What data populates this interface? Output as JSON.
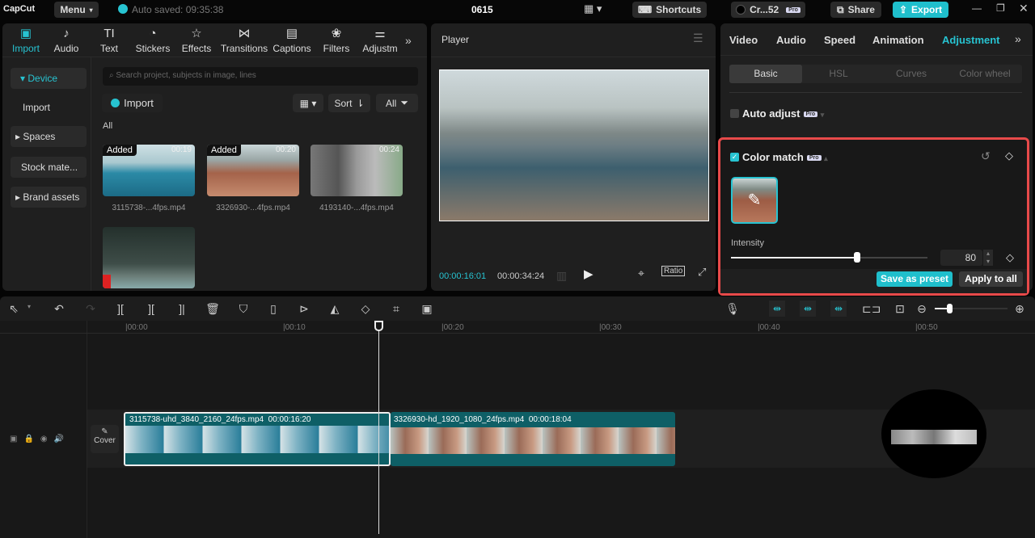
{
  "app": {
    "logo": "CapCut",
    "menu": "Menu",
    "autosave": "Auto saved: 09:35:38",
    "project": "0615",
    "shortcuts": "Shortcuts",
    "account": "Cr...52",
    "pro": "Pro",
    "share": "Share",
    "export": "Export"
  },
  "media_tabs": [
    {
      "label": "Import",
      "icon": "import-icon"
    },
    {
      "label": "Audio",
      "icon": "audio-icon"
    },
    {
      "label": "Text",
      "icon": "text-icon"
    },
    {
      "label": "Stickers",
      "icon": "stickers-icon"
    },
    {
      "label": "Effects",
      "icon": "effects-icon"
    },
    {
      "label": "Transitions",
      "icon": "transitions-icon"
    },
    {
      "label": "Captions",
      "icon": "captions-icon"
    },
    {
      "label": "Filters",
      "icon": "filters-icon"
    },
    {
      "label": "Adjustm",
      "icon": "adjustment-icon"
    }
  ],
  "sidebar": [
    "Device",
    "Import",
    "Spaces",
    "Stock mate...",
    "Brand assets"
  ],
  "media": {
    "search_placeholder": "Search project, subjects in image, lines",
    "import": "Import",
    "sort": "Sort",
    "all": "All",
    "section": "All",
    "items": [
      {
        "name": "3115738-...4fps.mp4",
        "badge": "Added",
        "duration": "00:19"
      },
      {
        "name": "3326930-...4fps.mp4",
        "badge": "Added",
        "duration": "00:20"
      },
      {
        "name": "4193140-...4fps.mp4",
        "badge": "",
        "duration": "00:24"
      },
      {
        "name": "",
        "badge": "",
        "duration": ""
      }
    ]
  },
  "player": {
    "title": "Player",
    "current": "00:00:16:01",
    "total": "00:00:34:24",
    "ratio": "Ratio"
  },
  "inspector": {
    "tabs": [
      "Video",
      "Audio",
      "Speed",
      "Animation",
      "Adjustment"
    ],
    "active_tab": "Adjustment",
    "subtabs": [
      "Basic",
      "HSL",
      "Curves",
      "Color wheel"
    ],
    "auto_adjust": "Auto adjust",
    "color_match": "Color match",
    "intensity_label": "Intensity",
    "intensity": 80,
    "save_preset": "Save as preset",
    "apply_all": "Apply to all"
  },
  "timeline": {
    "ticks": [
      "00:00",
      "00:10",
      "00:20",
      "00:30",
      "00:40",
      "00:50"
    ],
    "cover": "Cover",
    "clips": [
      {
        "name": "3115738-uhd_3840_2160_24fps.mp4",
        "duration": "00:00:16:20"
      },
      {
        "name": "3326930-hd_1920_1080_24fps.mp4",
        "duration": "00:00:18:04"
      }
    ],
    "zoom_level": 0.2
  },
  "colors": {
    "accent": "#27c3d1",
    "highlight": "#e84a4a",
    "clip": "#0e5f66"
  }
}
